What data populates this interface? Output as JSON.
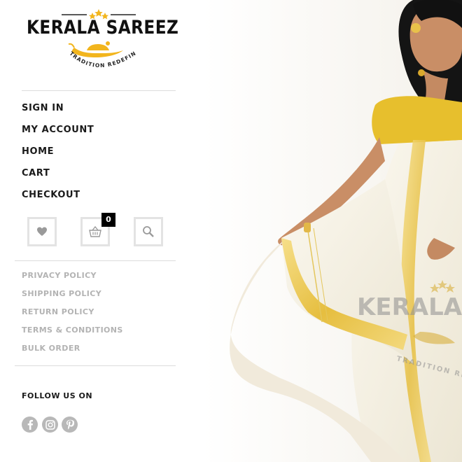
{
  "logo": {
    "brand": "KERALA SAREEZ",
    "tagline": "TRADITION REDEFINED"
  },
  "main_nav": [
    {
      "label": "SIGN IN"
    },
    {
      "label": "MY ACCOUNT"
    },
    {
      "label": "HOME"
    },
    {
      "label": "CART"
    },
    {
      "label": "CHECKOUT"
    }
  ],
  "icons": {
    "wishlist": "heart-icon",
    "cart": "basket-icon",
    "search": "search-icon",
    "cart_count": "0"
  },
  "policy_nav": [
    {
      "label": "PRIVACY POLICY"
    },
    {
      "label": "SHIPPING POLICY"
    },
    {
      "label": "RETURN POLICY"
    },
    {
      "label": "TERMS & CONDITIONS"
    },
    {
      "label": "BULK ORDER"
    }
  ],
  "follow": {
    "title": "FOLLOW US ON",
    "networks": [
      "facebook-icon",
      "instagram-icon",
      "pinterest-icon"
    ]
  },
  "hero": {
    "watermark_brand": "KERALA SAREEZ",
    "watermark_tagline": "TRADITION REDEFINED"
  },
  "colors": {
    "accent_gold": "#f2b51d",
    "text_dark": "#1a1a1a",
    "text_muted": "#b3b3b3",
    "icon_gray": "#b8b8b8"
  }
}
